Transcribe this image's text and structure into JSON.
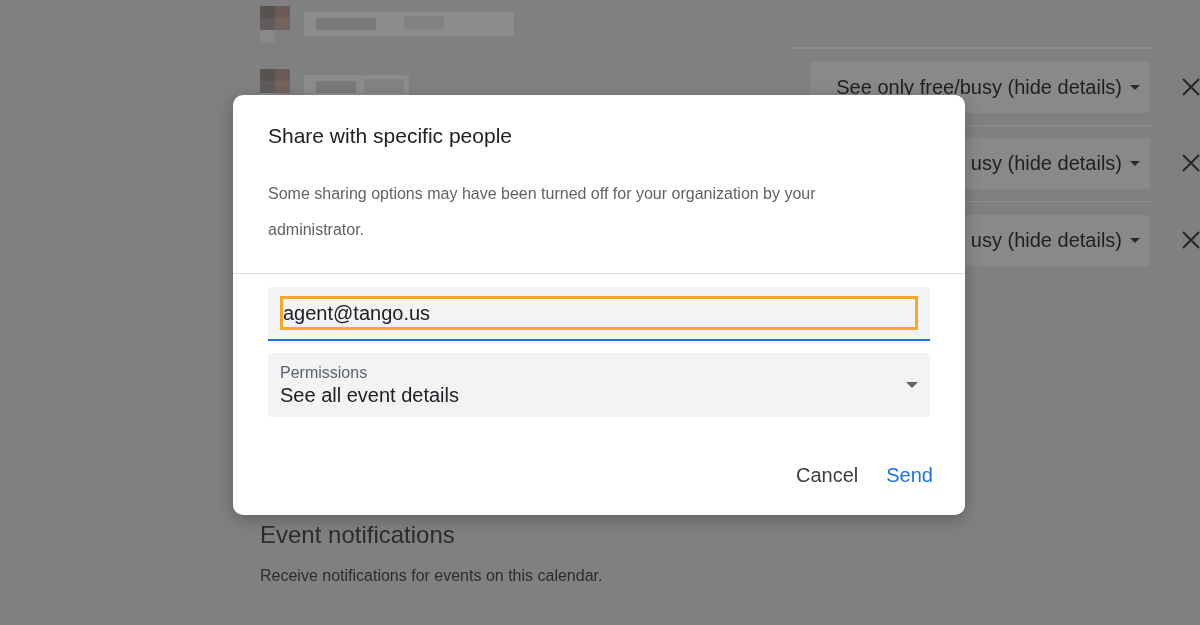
{
  "background": {
    "people": [
      {
        "kind": "redacted"
      },
      {
        "kind": "redacted",
        "access": "See only free/busy (hide details)"
      },
      {
        "kind": "hidden",
        "access": "usy (hide details)"
      },
      {
        "kind": "hidden",
        "access": "usy (hide details)"
      }
    ],
    "notifications": {
      "heading": "Event notifications",
      "description": "Receive notifications for events on this calendar."
    }
  },
  "dialog": {
    "title": "Share with specific people",
    "notice": "Some sharing options may have been turned off for your organization by your administrator.",
    "email": {
      "value": "agent@tango.us",
      "focused": true,
      "highlighted": true
    },
    "permissions": {
      "label": "Permissions",
      "value": "See all event details"
    },
    "buttons": [
      {
        "label": "Cancel",
        "kind": "text"
      },
      {
        "label": "Send",
        "kind": "primary"
      }
    ]
  }
}
